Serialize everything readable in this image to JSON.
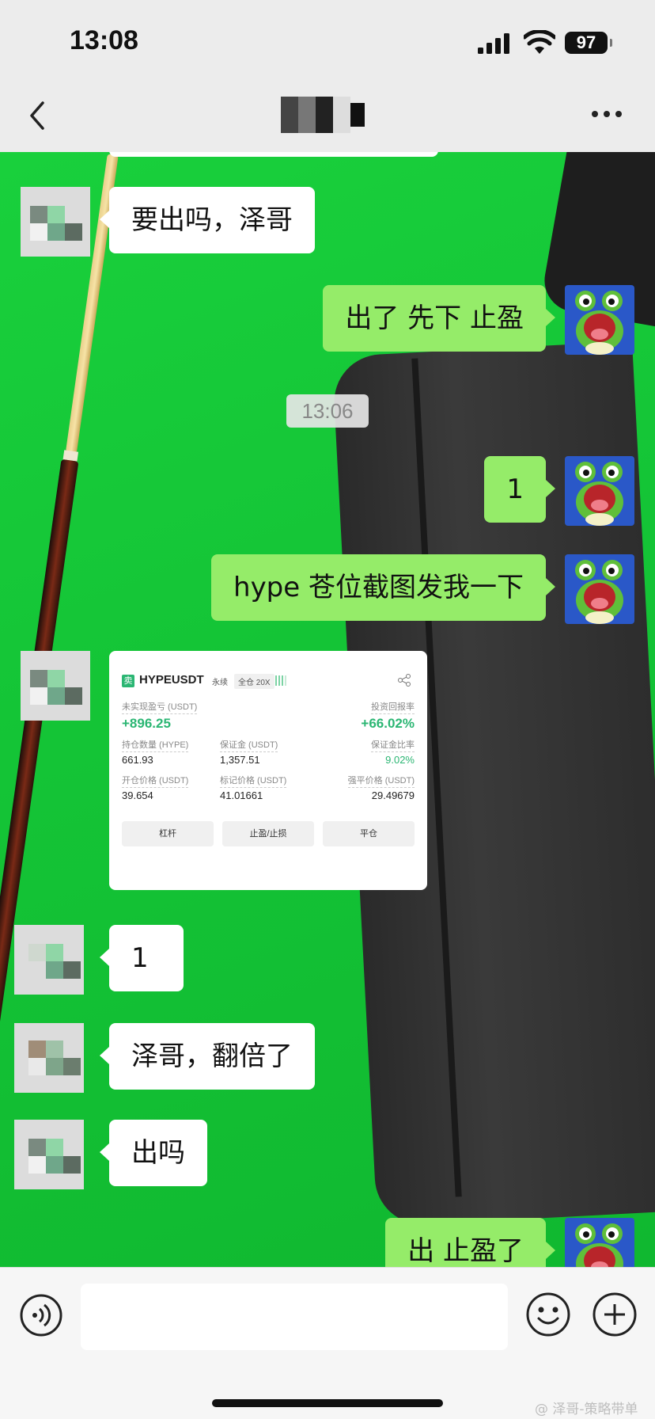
{
  "status_bar": {
    "time": "13:08",
    "battery": "97"
  },
  "nav": {
    "title": ""
  },
  "messages": [
    {
      "from": "other",
      "type": "text",
      "text": "要出吗，泽哥"
    },
    {
      "from": "me",
      "type": "text",
      "text": "出了 先下 止盈"
    },
    {
      "type": "time",
      "text": "13:06"
    },
    {
      "from": "me",
      "type": "text",
      "text": "1"
    },
    {
      "from": "me",
      "type": "text",
      "text": "hype 苍位截图发我一下"
    },
    {
      "from": "other",
      "type": "image"
    },
    {
      "from": "other",
      "type": "text",
      "text": "1"
    },
    {
      "from": "other",
      "type": "text",
      "text": "泽哥，翻倍了"
    },
    {
      "from": "other",
      "type": "text",
      "text": "出吗"
    },
    {
      "from": "me",
      "type": "text",
      "text": "出 止盈了"
    }
  ],
  "trade_card": {
    "side_tag": "卖",
    "symbol": "HYPEUSDT",
    "contract_type": "永续",
    "margin_mode": "全仓 20X",
    "unrealized_pnl": {
      "label": "未实现盈亏 (USDT)",
      "value": "+896.25"
    },
    "roi": {
      "label": "投资回报率",
      "value": "+66.02%"
    },
    "position_size": {
      "label": "持仓数量 (HYPE)",
      "value": "661.93"
    },
    "margin": {
      "label": "保证金 (USDT)",
      "value": "1,357.51"
    },
    "margin_ratio": {
      "label": "保证金比率",
      "value": "9.02%"
    },
    "entry_price": {
      "label": "开仓价格 (USDT)",
      "value": "39.654"
    },
    "mark_price": {
      "label": "标记价格 (USDT)",
      "value": "41.01661"
    },
    "liq_price": {
      "label": "强平价格 (USDT)",
      "value": "29.49679"
    },
    "buttons": [
      "杠杆",
      "止盈/止损",
      "平仓"
    ]
  },
  "watermark": "@ 泽哥-策略带单",
  "colors": {
    "bubble_out": "#95ec69",
    "bubble_in": "#ffffff",
    "profit_green": "#2bb673"
  },
  "icons": [
    "back-icon",
    "more-icon",
    "voice-icon",
    "emoji-icon",
    "plus-icon",
    "share-icon"
  ]
}
